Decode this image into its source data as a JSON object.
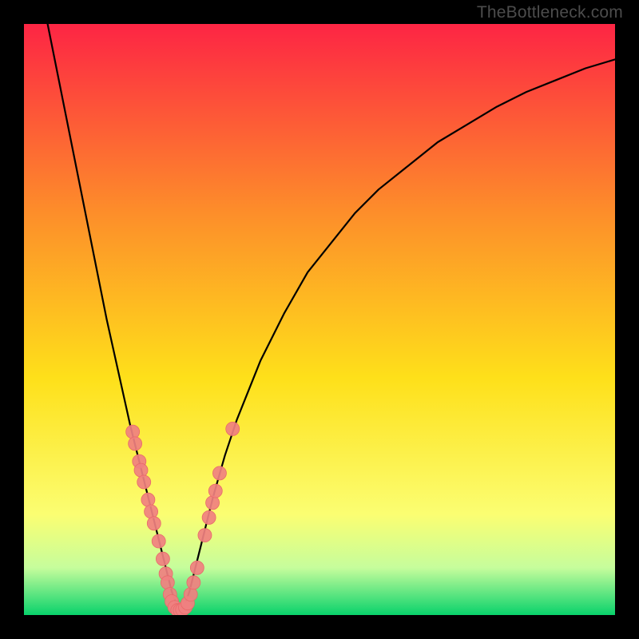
{
  "watermark": "TheBottleneck.com",
  "colors": {
    "bg_top": "#fd2544",
    "bg_mid1": "#fd8e2a",
    "bg_mid2": "#fee01a",
    "bg_low1": "#fbfe72",
    "bg_low2": "#c6fd9c",
    "bg_bottom": "#09d26b",
    "frame": "#000000",
    "curve": "#000000",
    "dot_fill": "#f08080",
    "dot_stroke": "#e86a6a"
  },
  "chart_data": {
    "type": "line",
    "title": "",
    "xlabel": "",
    "ylabel": "",
    "xlim": [
      0,
      100
    ],
    "ylim": [
      0,
      100
    ],
    "optimum_x": 26,
    "series": [
      {
        "name": "bottleneck-curve",
        "x": [
          4,
          6,
          8,
          10,
          12,
          14,
          16,
          18,
          19,
          20,
          21,
          22,
          23,
          24,
          25,
          26,
          27,
          28,
          29,
          30,
          31,
          32,
          34,
          36,
          38,
          40,
          44,
          48,
          52,
          56,
          60,
          65,
          70,
          75,
          80,
          85,
          90,
          95,
          100
        ],
        "y": [
          100,
          90,
          80,
          70,
          60,
          50,
          41,
          32,
          28,
          24,
          20,
          16,
          12,
          8,
          4,
          1,
          1,
          4,
          8,
          12,
          16,
          20,
          27,
          33,
          38,
          43,
          51,
          58,
          63,
          68,
          72,
          76,
          80,
          83,
          86,
          88.5,
          90.5,
          92.5,
          94
        ]
      }
    ],
    "scatter": {
      "name": "sampled-configurations",
      "points": [
        {
          "x": 18.4,
          "y": 31.0
        },
        {
          "x": 18.8,
          "y": 29.0
        },
        {
          "x": 19.5,
          "y": 26.0
        },
        {
          "x": 19.8,
          "y": 24.5
        },
        {
          "x": 20.3,
          "y": 22.5
        },
        {
          "x": 21.0,
          "y": 19.5
        },
        {
          "x": 21.5,
          "y": 17.5
        },
        {
          "x": 22.0,
          "y": 15.5
        },
        {
          "x": 22.8,
          "y": 12.5
        },
        {
          "x": 23.5,
          "y": 9.5
        },
        {
          "x": 24.0,
          "y": 7.0
        },
        {
          "x": 24.3,
          "y": 5.5
        },
        {
          "x": 24.7,
          "y": 3.5
        },
        {
          "x": 25.0,
          "y": 2.3
        },
        {
          "x": 25.5,
          "y": 1.3
        },
        {
          "x": 26.0,
          "y": 0.8
        },
        {
          "x": 26.4,
          "y": 0.8
        },
        {
          "x": 26.8,
          "y": 0.9
        },
        {
          "x": 27.3,
          "y": 1.3
        },
        {
          "x": 27.7,
          "y": 2.0
        },
        {
          "x": 28.2,
          "y": 3.5
        },
        {
          "x": 28.7,
          "y": 5.5
        },
        {
          "x": 29.3,
          "y": 8.0
        },
        {
          "x": 30.6,
          "y": 13.5
        },
        {
          "x": 31.3,
          "y": 16.5
        },
        {
          "x": 31.9,
          "y": 19.0
        },
        {
          "x": 32.4,
          "y": 21.0
        },
        {
          "x": 33.1,
          "y": 24.0
        },
        {
          "x": 35.3,
          "y": 31.5
        }
      ]
    }
  }
}
